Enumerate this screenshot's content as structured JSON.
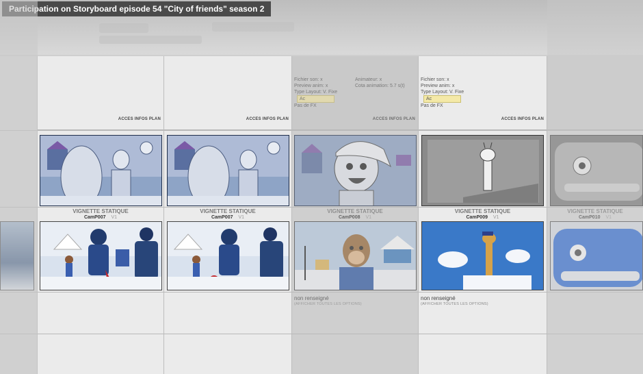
{
  "title": "Participation on Storyboard episode 54 \"City of friends\" season 2",
  "acces_label": "ACCES INFOS PLAN",
  "columns": [
    {
      "vignette": "VIGNETTE STATIQUE",
      "cam": "CamP007",
      "version": "V1"
    },
    {
      "vignette": "VIGNETTE STATIQUE",
      "cam": "CamP007",
      "version": "V1"
    },
    {
      "vignette": "VIGNETTE STATIQUE",
      "cam": "CamP008",
      "version": "V1",
      "info": [
        "Fichier son: x",
        "Preview anim: x",
        "Type Layout: V. Fixe",
        "Pas de FX"
      ],
      "info2": [
        "Animateur: x",
        "Cota animation: 5.7 s(t)"
      ],
      "badge": "Ac",
      "status": "non renseigné",
      "status_sub": "(AFFICHER TOUTES LES OPTIONS)"
    },
    {
      "vignette": "VIGNETTE STATIQUE",
      "cam": "CamP009",
      "version": "V1",
      "info": [
        "Fichier son: x",
        "Preview anim: x",
        "Type Layout: V. Fixe",
        "Pas de FX"
      ],
      "badge": "Ac",
      "status": "non renseigné",
      "status_sub": "(AFFICHER TOUTES LES OPTIONS)"
    },
    {
      "vignette": "VIGNETTE STATIQUE",
      "cam": "CamP010",
      "version": "V1"
    }
  ]
}
